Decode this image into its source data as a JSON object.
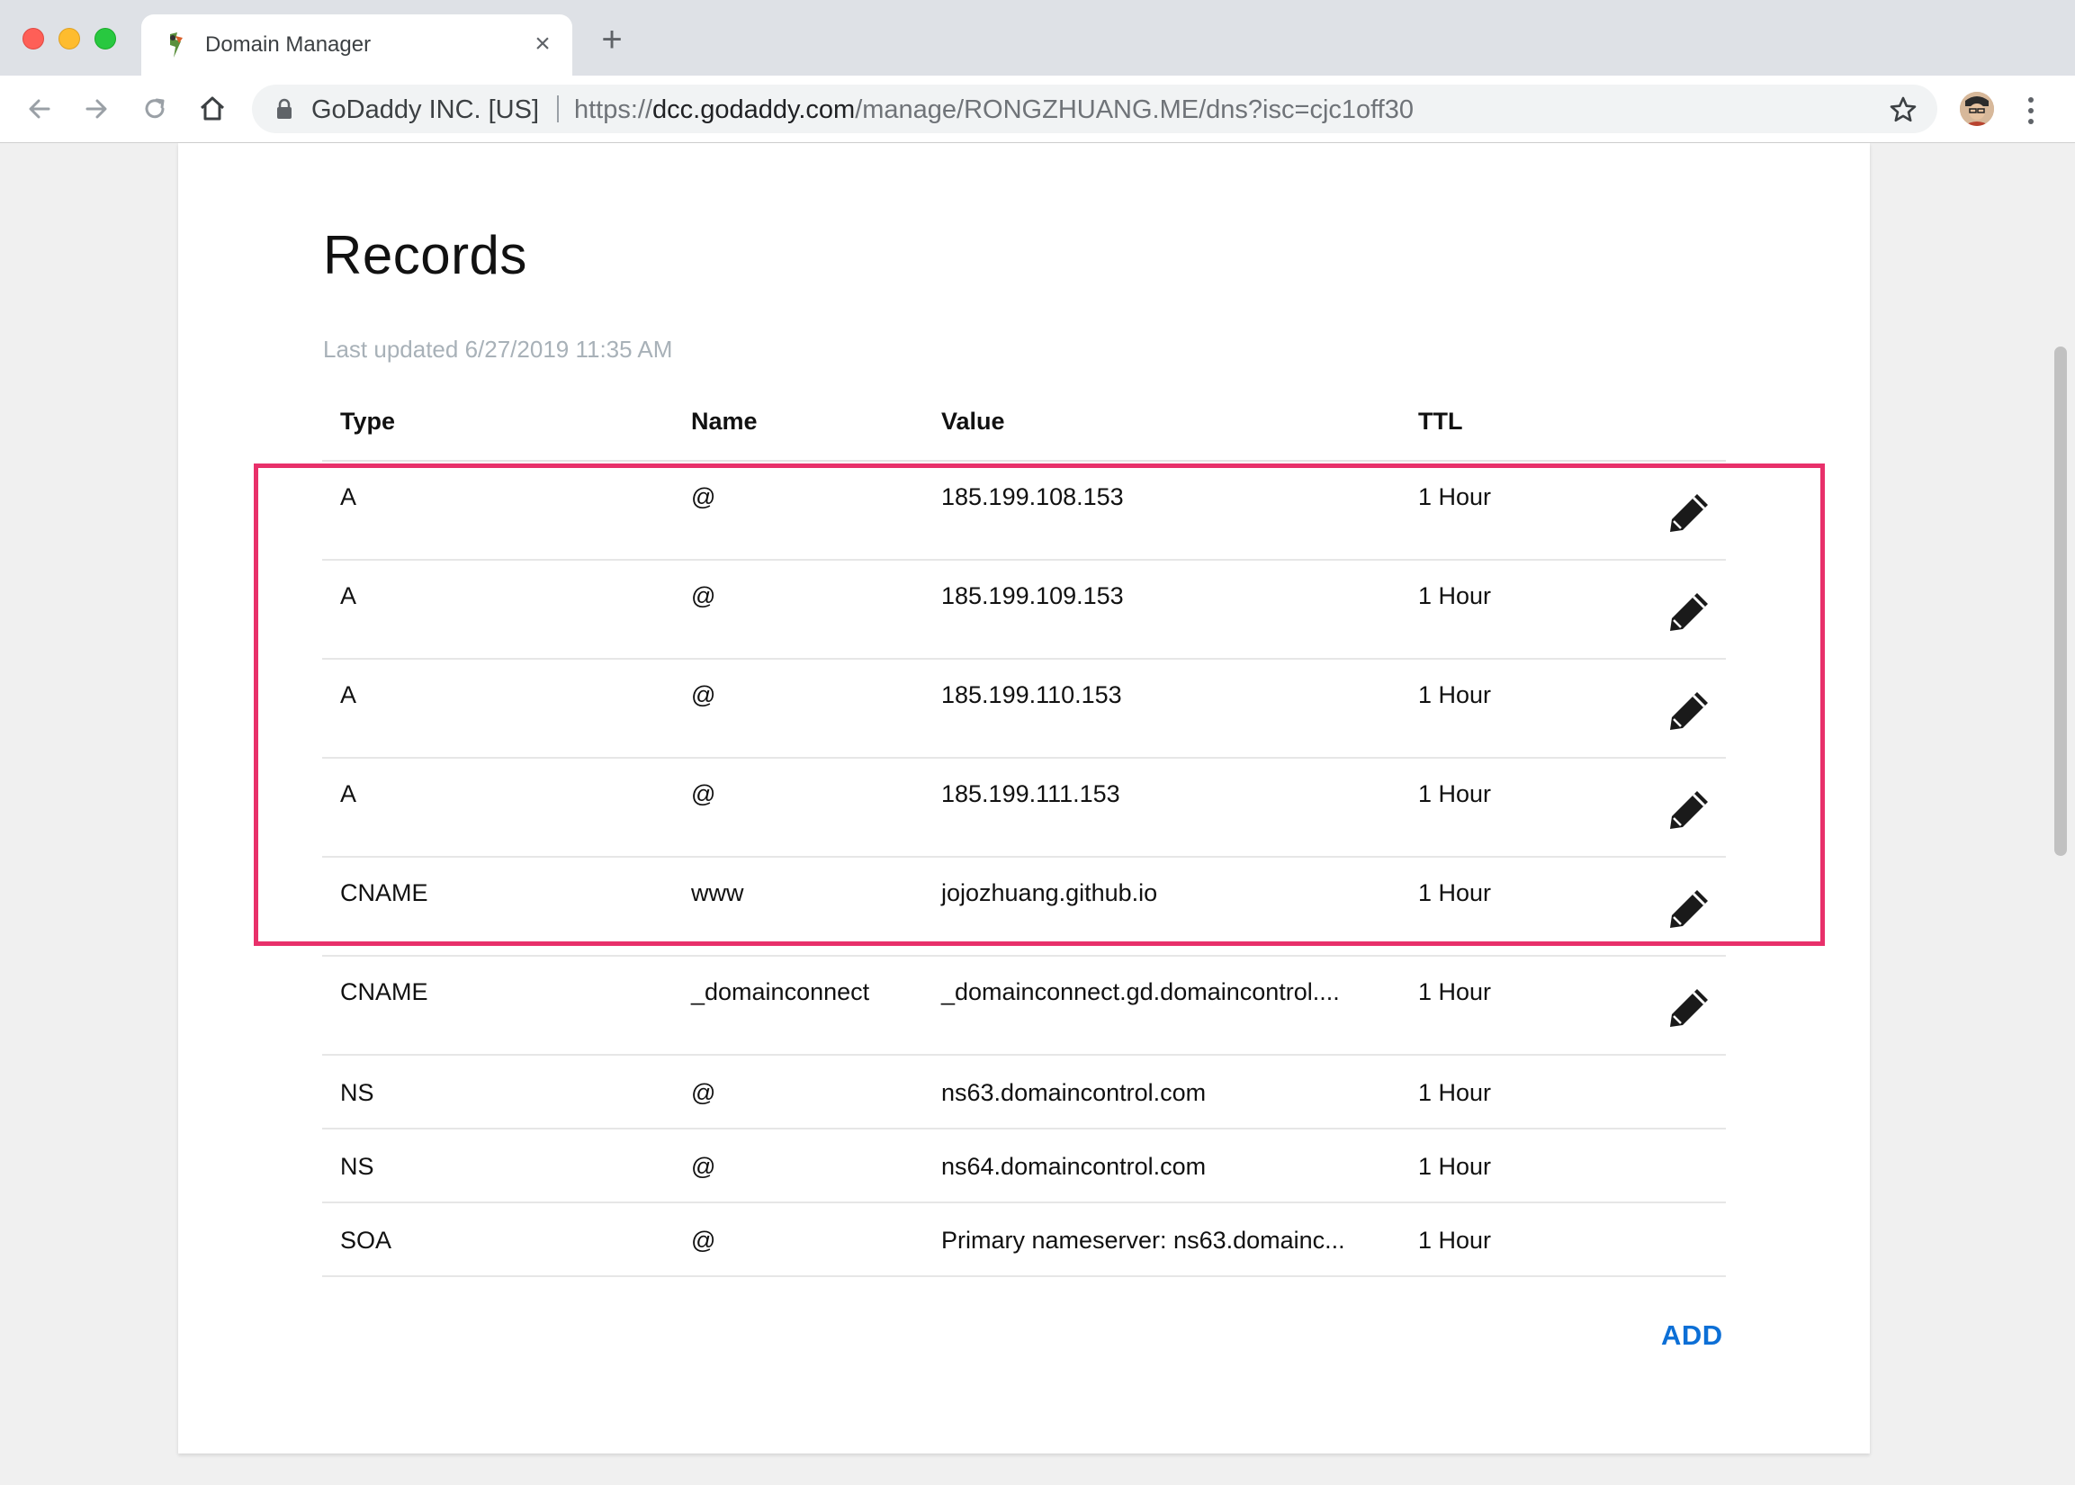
{
  "browser": {
    "tab_title": "Domain Manager",
    "tab_close": "×",
    "new_tab": "+",
    "site_name": "GoDaddy INC. [US]",
    "url_scheme": "https://",
    "url_host": "dcc.godaddy.com",
    "url_path": "/manage/RONGZHUANG.ME/dns?isc=cjc1off30"
  },
  "page": {
    "title": "Records",
    "last_updated": "Last updated 6/27/2019 11:35 AM",
    "add_label": "ADD"
  },
  "table": {
    "headers": {
      "type": "Type",
      "name": "Name",
      "value": "Value",
      "ttl": "TTL"
    },
    "rows": [
      {
        "type": "A",
        "name": "@",
        "value": "185.199.108.153",
        "ttl": "1 Hour",
        "editable": true
      },
      {
        "type": "A",
        "name": "@",
        "value": "185.199.109.153",
        "ttl": "1 Hour",
        "editable": true
      },
      {
        "type": "A",
        "name": "@",
        "value": "185.199.110.153",
        "ttl": "1 Hour",
        "editable": true
      },
      {
        "type": "A",
        "name": "@",
        "value": "185.199.111.153",
        "ttl": "1 Hour",
        "editable": true
      },
      {
        "type": "CNAME",
        "name": "www",
        "value": "jojozhuang.github.io",
        "ttl": "1 Hour",
        "editable": true
      },
      {
        "type": "CNAME",
        "name": "_domainconnect",
        "value": "_domainconnect.gd.domaincontrol....",
        "ttl": "1 Hour",
        "editable": true
      },
      {
        "type": "NS",
        "name": "@",
        "value": "ns63.domaincontrol.com",
        "ttl": "1 Hour",
        "editable": false
      },
      {
        "type": "NS",
        "name": "@",
        "value": "ns64.domaincontrol.com",
        "ttl": "1 Hour",
        "editable": false
      },
      {
        "type": "SOA",
        "name": "@",
        "value": "Primary nameserver: ns63.domainc...",
        "ttl": "1 Hour",
        "editable": false
      }
    ]
  },
  "colors": {
    "highlight": "#e8306a",
    "link": "#0c6fd6",
    "muted_text": "#a8b1b8"
  },
  "icons": {
    "edit": "pencil-icon",
    "lock": "lock-icon",
    "bookmark": "star-icon",
    "back": "back-arrow-icon",
    "forward": "forward-arrow-icon",
    "reload": "reload-icon",
    "home": "home-icon",
    "menu": "kebab-menu-icon"
  }
}
